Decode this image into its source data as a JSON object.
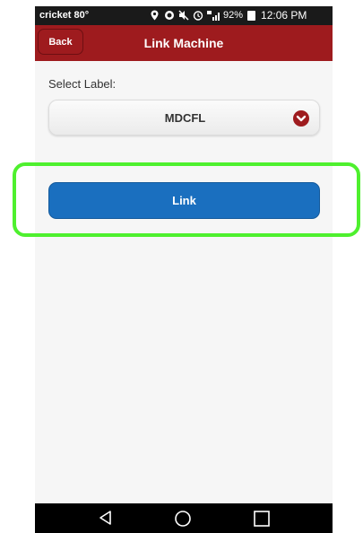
{
  "status_bar": {
    "carrier": "cricket 80°",
    "battery_percent": "92%",
    "time": "12:06 PM"
  },
  "header": {
    "back_label": "Back",
    "title": "Link Machine",
    "color": "#9e1b1e"
  },
  "form": {
    "select_label": "Select Label:",
    "selected_value": "MDCFL",
    "link_label": "Link",
    "link_color": "#1a6fbf"
  },
  "icons": {
    "status": [
      "location-icon",
      "sync-icon",
      "mute-icon",
      "alarm-icon",
      "lte-signal-icon",
      "battery-icon"
    ],
    "nav": [
      "nav-back-icon",
      "nav-home-icon",
      "nav-recent-icon"
    ]
  }
}
